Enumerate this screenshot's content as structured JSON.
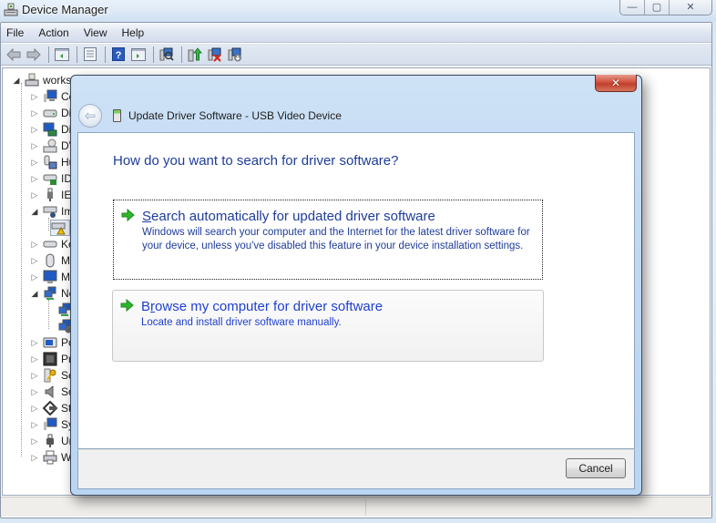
{
  "window": {
    "title": "Device Manager",
    "caption_buttons": {
      "minimize": "—",
      "maximize": "▢",
      "close": "✕"
    }
  },
  "menubar": {
    "items": [
      {
        "label": "File",
        "access_key": "F"
      },
      {
        "label": "Action",
        "access_key": "A"
      },
      {
        "label": "View",
        "access_key": "V"
      },
      {
        "label": "Help",
        "access_key": "H"
      }
    ]
  },
  "toolbar": {
    "buttons": [
      {
        "name": "back",
        "icon": "arrow-left-icon"
      },
      {
        "name": "forward",
        "icon": "arrow-right-icon"
      },
      {
        "name": "show-hide-console-tree",
        "icon": "console-tree-icon"
      },
      {
        "name": "properties",
        "icon": "properties-icon"
      },
      {
        "name": "help",
        "icon": "help-icon"
      },
      {
        "name": "show-hide-action-pane",
        "icon": "action-pane-icon"
      },
      {
        "name": "scan-hardware",
        "icon": "scan-hardware-icon"
      },
      {
        "name": "update-driver",
        "icon": "update-driver-icon"
      },
      {
        "name": "uninstall",
        "icon": "uninstall-icon"
      },
      {
        "name": "disable",
        "icon": "disable-device-icon"
      }
    ]
  },
  "tree": {
    "root": "works",
    "items": [
      {
        "label": "Co",
        "icon": "computer-icon",
        "expanded": false
      },
      {
        "label": "Di",
        "icon": "disk-drive-icon",
        "expanded": false
      },
      {
        "label": "Di",
        "icon": "display-adapter-icon",
        "expanded": false
      },
      {
        "label": "DV",
        "icon": "dvd-drive-icon",
        "expanded": false
      },
      {
        "label": "Hu",
        "icon": "hid-icon",
        "expanded": false
      },
      {
        "label": "ID",
        "icon": "ide-controller-icon",
        "expanded": false
      },
      {
        "label": "IE",
        "icon": "ieee1394-icon",
        "expanded": false
      },
      {
        "label": "Im",
        "icon": "imaging-device-icon",
        "expanded": true
      },
      {
        "label": "",
        "icon": "warning-device-icon",
        "child": true
      },
      {
        "label": "Ke",
        "icon": "keyboard-icon",
        "expanded": false
      },
      {
        "label": "Mi",
        "icon": "mouse-icon",
        "expanded": false
      },
      {
        "label": "Mo",
        "icon": "monitor-icon",
        "expanded": false
      },
      {
        "label": "Ne",
        "icon": "network-adapter-icon",
        "expanded": true
      },
      {
        "label": "",
        "icon": "network-adapter-icon",
        "child": true
      },
      {
        "label": "",
        "icon": "network-adapter-icon",
        "child": true
      },
      {
        "label": "Po",
        "icon": "port-icon",
        "expanded": false
      },
      {
        "label": "Pr",
        "icon": "processor-icon",
        "expanded": false
      },
      {
        "label": "Se",
        "icon": "security-device-icon",
        "expanded": false
      },
      {
        "label": "So",
        "icon": "sound-icon",
        "expanded": false
      },
      {
        "label": "St",
        "icon": "storage-controller-icon",
        "expanded": false
      },
      {
        "label": "Sy",
        "icon": "system-device-icon",
        "expanded": false
      },
      {
        "label": "Un",
        "icon": "usb-controller-icon",
        "expanded": false
      },
      {
        "label": "W",
        "icon": "printer-icon",
        "expanded": false
      }
    ]
  },
  "dialog": {
    "title": "Update Driver Software - USB Video Device",
    "close_label": "✕",
    "heading": "How do you want to search for driver software?",
    "options": [
      {
        "title_access": "S",
        "title_rest": "earch automatically for updated driver software",
        "description": "Windows will search your computer and the Internet for the latest driver software for your device, unless you've disabled this feature in your device installation settings.",
        "state": "focused"
      },
      {
        "title_pre": "B",
        "title_access": "r",
        "title_rest": "owse my computer for driver software",
        "description": "Locate and install driver software manually.",
        "state": "hover"
      }
    ],
    "cancel_label": "Cancel"
  },
  "colors": {
    "link_blue": "#1e3c9a",
    "hover_blue": "#1f3fd1",
    "arrow_green": "#2fb52f",
    "close_red": "#c9452f"
  }
}
